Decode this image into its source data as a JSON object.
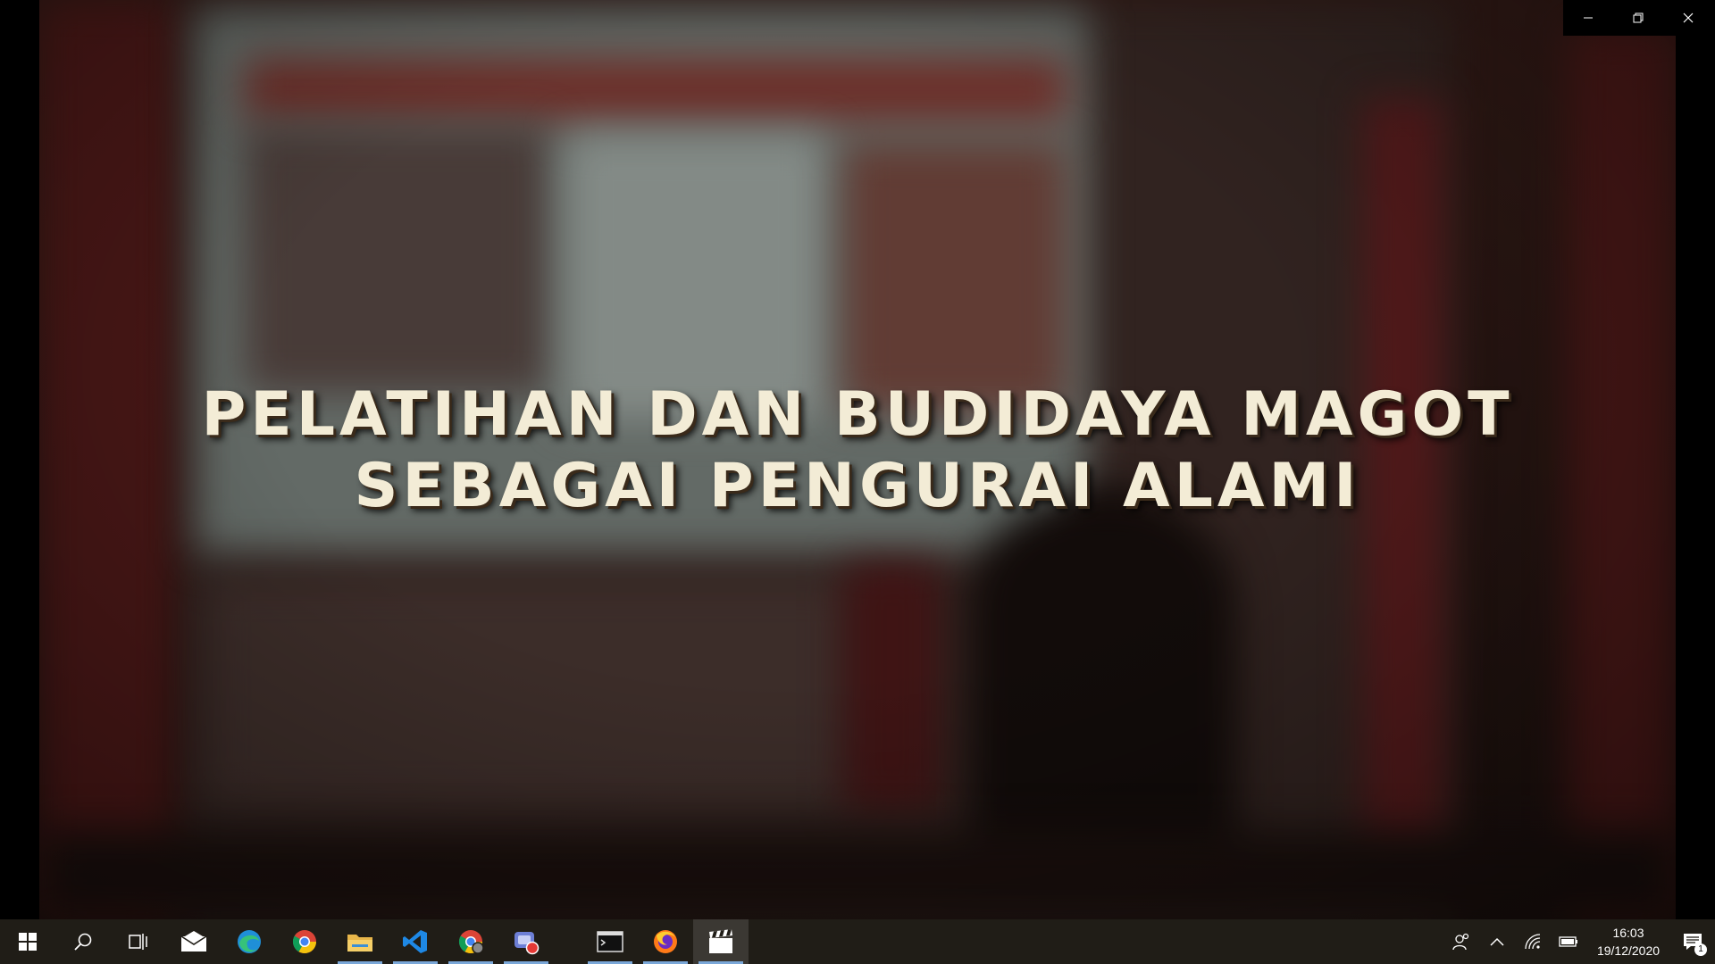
{
  "video": {
    "caption_line1": "PELATIHAN DAN BUDIDAYA MAGOT",
    "caption_line2": "SEBAGAI PENGURAI ALAMI"
  },
  "window_controls": [
    "minimize-icon",
    "restore-icon",
    "close-icon"
  ],
  "taskbar": {
    "apps": [
      {
        "name": "start",
        "icon": "windows-logo-icon",
        "running": false
      },
      {
        "name": "search",
        "icon": "search-icon",
        "running": false
      },
      {
        "name": "task-view",
        "icon": "task-view-icon",
        "running": false
      },
      {
        "name": "mail",
        "icon": "mail-icon",
        "running": false
      },
      {
        "name": "edge",
        "icon": "edge-icon",
        "running": false
      },
      {
        "name": "chrome",
        "icon": "chrome-icon",
        "running": false
      },
      {
        "name": "file-explorer",
        "icon": "folder-icon",
        "running": true
      },
      {
        "name": "vscode",
        "icon": "vscode-icon",
        "running": true
      },
      {
        "name": "chrome-profile",
        "icon": "chrome-icon",
        "running": true
      },
      {
        "name": "screen-recorder",
        "icon": "recorder-icon",
        "running": true
      },
      {
        "name": "terminal",
        "icon": "terminal-icon",
        "running": true
      },
      {
        "name": "firefox",
        "icon": "firefox-icon",
        "running": true
      },
      {
        "name": "video-editor",
        "icon": "clapperboard-icon",
        "running": true,
        "active": true
      }
    ],
    "tray": {
      "time": "16:03",
      "date": "19/12/2020",
      "notification_count": "1"
    }
  },
  "colors": {
    "taskbar_bg": "#201d17",
    "running_indicator": "#7aa7d8",
    "caption_text": "#f3ecd6"
  }
}
